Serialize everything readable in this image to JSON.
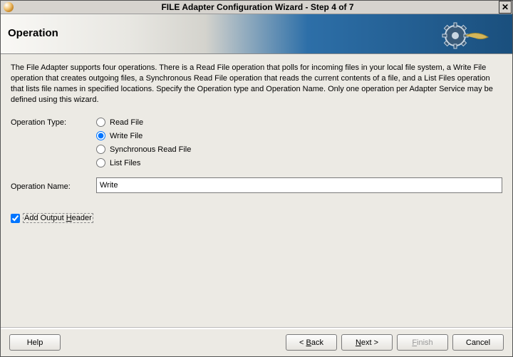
{
  "titlebar": {
    "title": "FILE Adapter Configuration Wizard - Step 4 of 7",
    "close_label": "✕"
  },
  "banner": {
    "heading": "Operation"
  },
  "description": "The File Adapter supports four operations.  There is a Read File operation that polls for incoming files in your local file system, a Write File operation that creates outgoing files, a Synchronous Read File operation that reads the current contents of a file, and a List Files operation that lists file names in specified locations.  Specify the Operation type and Operation Name.  Only one operation per Adapter Service may be defined using this wizard.",
  "operation_type": {
    "label": "Operation Type:",
    "options": [
      {
        "id": "read",
        "label": "Read File",
        "checked": false
      },
      {
        "id": "write",
        "label": "Write File",
        "checked": true
      },
      {
        "id": "sync",
        "label": "Synchronous Read File",
        "checked": false
      },
      {
        "id": "list",
        "label": "List Files",
        "checked": false
      }
    ]
  },
  "operation_name": {
    "label": "Operation Name:",
    "value": "Write"
  },
  "add_output_header": {
    "label": "Add Output Header",
    "checked": true
  },
  "buttons": {
    "help": "Help",
    "back": "< Back",
    "next": "Next >",
    "finish": "Finish",
    "cancel": "Cancel"
  }
}
